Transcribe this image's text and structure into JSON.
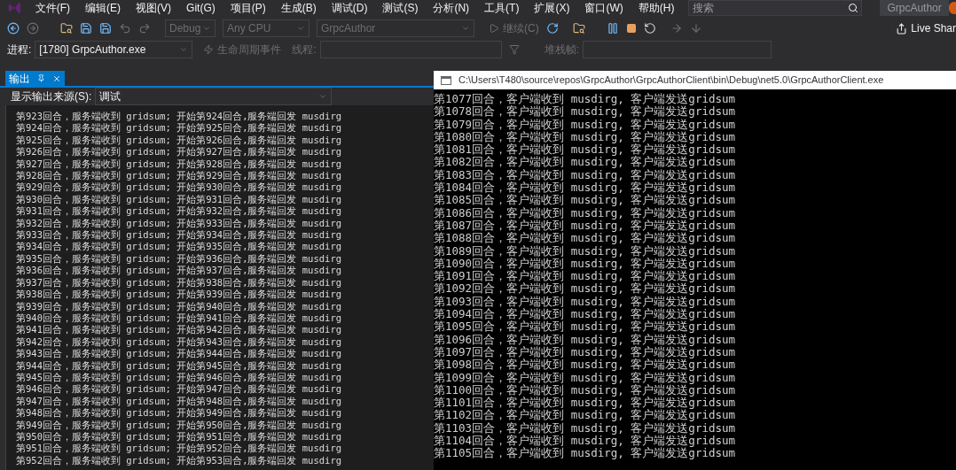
{
  "menu_bar": {
    "items": [
      "文件(F)",
      "编辑(E)",
      "视图(V)",
      "Git(G)",
      "项目(P)",
      "生成(B)",
      "调试(D)",
      "测试(S)",
      "分析(N)",
      "工具(T)",
      "扩展(X)",
      "窗口(W)",
      "帮助(H)"
    ],
    "search": {
      "placeholder": "搜索"
    },
    "solution_title": "GrpcAuthor"
  },
  "toolbar": {
    "configuration": "Debug",
    "platform": "Any CPU",
    "startup_project": "GrpcAuthor",
    "continue_button": "继续(C)",
    "live_share": "Live Shar"
  },
  "debug_location": {
    "process_label": "进程:",
    "process": "[1780] GrpcAuthor.exe",
    "lifecycle_events": "生命周期事件",
    "thread_label": "线程:",
    "stack_frame_label": "堆栈帧:"
  },
  "output_panel": {
    "tabs": [
      {
        "label": "输出",
        "selected": true
      }
    ],
    "source_label": "显示输出来源(S):",
    "source": "调试",
    "lines": [
      "第923回合，服务端收到 gridsum; 开始第924回合,服务端回发 musdirg",
      "第924回合，服务端收到 gridsum; 开始第925回合,服务端回发 musdirg",
      "第925回合，服务端收到 gridsum; 开始第926回合,服务端回发 musdirg",
      "第926回合，服务端收到 gridsum; 开始第927回合,服务端回发 musdirg",
      "第927回合，服务端收到 gridsum; 开始第928回合,服务端回发 musdirg",
      "第928回合，服务端收到 gridsum; 开始第929回合,服务端回发 musdirg",
      "第929回合，服务端收到 gridsum; 开始第930回合,服务端回发 musdirg",
      "第930回合，服务端收到 gridsum; 开始第931回合,服务端回发 musdirg",
      "第931回合，服务端收到 gridsum; 开始第932回合,服务端回发 musdirg",
      "第932回合，服务端收到 gridsum; 开始第933回合,服务端回发 musdirg",
      "第933回合，服务端收到 gridsum; 开始第934回合,服务端回发 musdirg",
      "第934回合，服务端收到 gridsum; 开始第935回合,服务端回发 musdirg",
      "第935回合，服务端收到 gridsum; 开始第936回合,服务端回发 musdirg",
      "第936回合，服务端收到 gridsum; 开始第937回合,服务端回发 musdirg",
      "第937回合，服务端收到 gridsum; 开始第938回合,服务端回发 musdirg",
      "第938回合，服务端收到 gridsum; 开始第939回合,服务端回发 musdirg",
      "第939回合，服务端收到 gridsum; 开始第940回合,服务端回发 musdirg",
      "第940回合，服务端收到 gridsum; 开始第941回合,服务端回发 musdirg",
      "第941回合，服务端收到 gridsum; 开始第942回合,服务端回发 musdirg",
      "第942回合，服务端收到 gridsum; 开始第943回合,服务端回发 musdirg",
      "第943回合，服务端收到 gridsum; 开始第944回合,服务端回发 musdirg",
      "第944回合，服务端收到 gridsum; 开始第945回合,服务端回发 musdirg",
      "第945回合，服务端收到 gridsum; 开始第946回合,服务端回发 musdirg",
      "第946回合，服务端收到 gridsum; 开始第947回合,服务端回发 musdirg",
      "第947回合，服务端收到 gridsum; 开始第948回合,服务端回发 musdirg",
      "第948回合，服务端收到 gridsum; 开始第949回合,服务端回发 musdirg",
      "第949回合，服务端收到 gridsum; 开始第950回合,服务端回发 musdirg",
      "第950回合，服务端收到 gridsum; 开始第951回合,服务端回发 musdirg",
      "第951回合，服务端收到 gridsum; 开始第952回合,服务端回发 musdirg",
      "第952回合，服务端收到 gridsum; 开始第953回合,服务端回发 musdirg"
    ]
  },
  "console_window": {
    "title": "C:\\Users\\T480\\source\\repos\\GrpcAuthor\\GrpcAuthorClient\\bin\\Debug\\net5.0\\GrpcAuthorClient.exe",
    "lines": [
      "第1077回合，客户端收到 musdirg, 客户端发送gridsum",
      "第1078回合，客户端收到 musdirg, 客户端发送gridsum",
      "第1079回合，客户端收到 musdirg, 客户端发送gridsum",
      "第1080回合，客户端收到 musdirg, 客户端发送gridsum",
      "第1081回合，客户端收到 musdirg, 客户端发送gridsum",
      "第1082回合，客户端收到 musdirg, 客户端发送gridsum",
      "第1083回合，客户端收到 musdirg, 客户端发送gridsum",
      "第1084回合，客户端收到 musdirg, 客户端发送gridsum",
      "第1085回合，客户端收到 musdirg, 客户端发送gridsum",
      "第1086回合，客户端收到 musdirg, 客户端发送gridsum",
      "第1087回合，客户端收到 musdirg, 客户端发送gridsum",
      "第1088回合，客户端收到 musdirg, 客户端发送gridsum",
      "第1089回合，客户端收到 musdirg, 客户端发送gridsum",
      "第1090回合，客户端收到 musdirg, 客户端发送gridsum",
      "第1091回合，客户端收到 musdirg, 客户端发送gridsum",
      "第1092回合，客户端收到 musdirg, 客户端发送gridsum",
      "第1093回合，客户端收到 musdirg, 客户端发送gridsum",
      "第1094回合，客户端收到 musdirg, 客户端发送gridsum",
      "第1095回合，客户端收到 musdirg, 客户端发送gridsum",
      "第1096回合，客户端收到 musdirg, 客户端发送gridsum",
      "第1097回合，客户端收到 musdirg, 客户端发送gridsum",
      "第1098回合，客户端收到 musdirg, 客户端发送gridsum",
      "第1099回合，客户端收到 musdirg, 客户端发送gridsum",
      "第1100回合，客户端收到 musdirg, 客户端发送gridsum",
      "第1101回合，客户端收到 musdirg, 客户端发送gridsum",
      "第1102回合，客户端收到 musdirg, 客户端发送gridsum",
      "第1103回合，客户端收到 musdirg, 客户端发送gridsum",
      "第1104回合，客户端收到 musdirg, 客户端发送gridsum",
      "第1105回合，客户端收到 musdirg, 客户端发送gridsum"
    ]
  }
}
